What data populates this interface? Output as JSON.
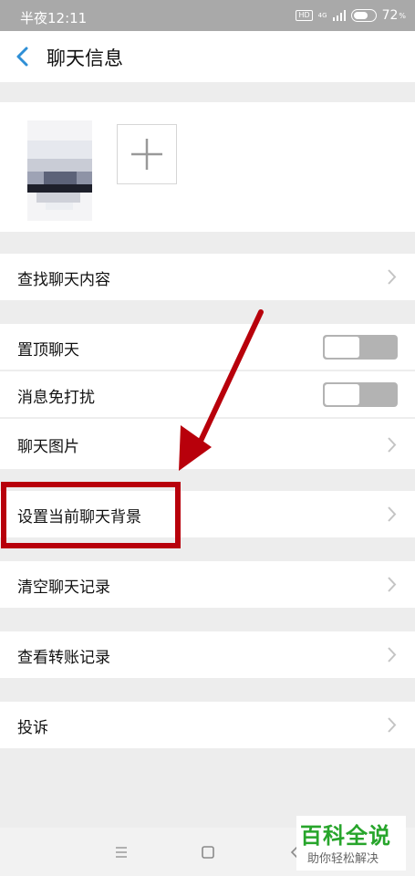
{
  "status_bar": {
    "time": "半夜12:11",
    "hd": "HD",
    "network": "4G",
    "battery": "72"
  },
  "header": {
    "title": "聊天信息"
  },
  "rows": {
    "search_chat": "查找聊天内容",
    "pin_chat": "置顶聊天",
    "mute": "消息免打扰",
    "chat_images": "聊天图片",
    "set_background": "设置当前聊天背景",
    "clear_history": "清空聊天记录",
    "transfer_records": "查看转账记录",
    "report": "投诉"
  },
  "toggles": {
    "pin_chat": "off",
    "mute": "off"
  },
  "colors": {
    "highlight": "#b8000b",
    "watermark_green": "#27a52b",
    "back_arrow": "#2e8fd6"
  },
  "watermark": {
    "title": "百科全说",
    "subtitle": "助你轻松解决"
  }
}
